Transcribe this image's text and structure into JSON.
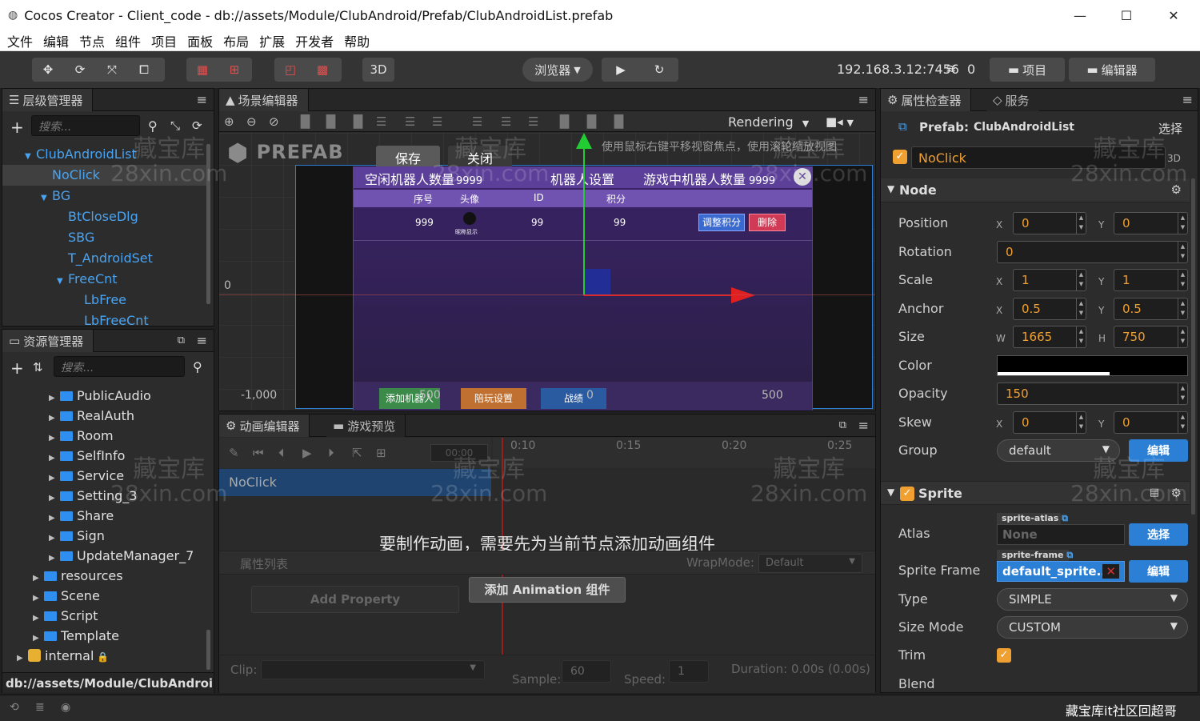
{
  "window": {
    "title": "Cocos Creator - Client_code - db://assets/Module/ClubAndroid/Prefab/ClubAndroidList.prefab"
  },
  "menu": [
    "文件",
    "编辑",
    "节点",
    "组件",
    "项目",
    "面板",
    "布局",
    "扩展",
    "开发者",
    "帮助"
  ],
  "toolbar": {
    "mode3d": "3D",
    "browser": "浏览器",
    "ip": "192.168.3.12:7456",
    "ip_count": "0",
    "project_btn": "项目",
    "editor_btn": "编辑器"
  },
  "hierarchy": {
    "title": "层级管理器",
    "search_placeholder": "搜索...",
    "items": [
      {
        "label": "ClubAndroidList",
        "indent": 0,
        "arrow": "▼"
      },
      {
        "label": "NoClick",
        "indent": 1,
        "arrow": ""
      },
      {
        "label": "BG",
        "indent": 1,
        "arrow": "▼"
      },
      {
        "label": "BtCloseDlg",
        "indent": 2,
        "arrow": ""
      },
      {
        "label": "SBG",
        "indent": 2,
        "arrow": ""
      },
      {
        "label": "T_AndroidSet",
        "indent": 2,
        "arrow": ""
      },
      {
        "label": "FreeCnt",
        "indent": 2,
        "arrow": "▼"
      },
      {
        "label": "LbFree",
        "indent": 3,
        "arrow": ""
      },
      {
        "label": "LbFreeCnt",
        "indent": 3,
        "arrow": ""
      }
    ]
  },
  "assets": {
    "title": "资源管理器",
    "search_placeholder": "搜索...",
    "items": [
      {
        "label": "PublicAudio",
        "indent": 2
      },
      {
        "label": "RealAuth",
        "indent": 2
      },
      {
        "label": "Room",
        "indent": 2
      },
      {
        "label": "SelfInfo",
        "indent": 2
      },
      {
        "label": "Service",
        "indent": 2
      },
      {
        "label": "Setting_3",
        "indent": 2
      },
      {
        "label": "Share",
        "indent": 2
      },
      {
        "label": "Sign",
        "indent": 2
      },
      {
        "label": "UpdateManager_7",
        "indent": 2
      },
      {
        "label": "resources",
        "indent": 1
      },
      {
        "label": "Scene",
        "indent": 1
      },
      {
        "label": "Script",
        "indent": 1
      },
      {
        "label": "Template",
        "indent": 1
      }
    ],
    "internal": "internal",
    "path": "db://assets/Module/ClubAndroi..."
  },
  "scene": {
    "title": "场景编辑器",
    "rendering": "Rendering",
    "prefab_label": "PREFAB",
    "save": "保存",
    "close": "关闭",
    "hint": "使用鼠标右键平移视窗焦点，使用滚轮缩放视图",
    "axis_0": "0",
    "axis_m1000": "-1,000",
    "axis_500": "500",
    "game": {
      "idle": "空闲机器人数量",
      "idle_num": "9999",
      "settings": "机器人设置",
      "ingame": "游戏中机器人数量",
      "ingame_num": "9999",
      "cols": [
        "序号",
        "头像",
        "ID",
        "积分"
      ],
      "row": {
        "no": "999",
        "name": "昵称显示",
        "id": "99",
        "score": "99"
      },
      "btn_adjust": "调整积分",
      "btn_delete": "删除",
      "btn_add": "添加机器人",
      "btn_play": "陪玩设置",
      "btn_record": "战绩",
      "bottom_nums": [
        "500",
        "0"
      ]
    }
  },
  "anim": {
    "tab_anim": "动画编辑器",
    "tab_preview": "游戏预览",
    "time_field": "00:00",
    "ruler": [
      "0:10",
      "0:15",
      "0:20",
      "0:25"
    ],
    "node": "NoClick",
    "msg": "要制作动画，需要先为当前节点添加动画组件",
    "prop_list": "属性列表",
    "wrap_label": "WrapMode:",
    "wrap_value": "Default",
    "add_property": "Add Property",
    "add_anim": "添加 Animation 组件",
    "clip_label": "Clip:",
    "sample_label": "Sample:",
    "sample_value": "60",
    "speed_label": "Speed:",
    "speed_value": "1",
    "duration": "Duration: 0.00s (0.00s)"
  },
  "inspector": {
    "tab_props": "属性检查器",
    "tab_service": "服务",
    "prefab_label": "Prefab:",
    "prefab_name": "ClubAndroidList",
    "select": "选择",
    "node_name": "NoClick",
    "tag_3d": "3D",
    "node_section": "Node",
    "position": {
      "label": "Position",
      "x": "0",
      "y": "0"
    },
    "rotation": {
      "label": "Rotation",
      "value": "0"
    },
    "scale": {
      "label": "Scale",
      "x": "1",
      "y": "1"
    },
    "anchor": {
      "label": "Anchor",
      "x": "0.5",
      "y": "0.5"
    },
    "size": {
      "label": "Size",
      "w": "1665",
      "h": "750"
    },
    "color": {
      "label": "Color",
      "value": "#000000"
    },
    "opacity": {
      "label": "Opacity",
      "value": "150"
    },
    "skew": {
      "label": "Skew",
      "x": "0",
      "y": "0"
    },
    "group": {
      "label": "Group",
      "value": "default",
      "edit": "编辑"
    },
    "sprite_section": "Sprite",
    "atlas": {
      "label": "Atlas",
      "tag": "sprite-atlas",
      "value": "None",
      "btn": "选择"
    },
    "sprite_frame": {
      "label": "Sprite Frame",
      "tag": "sprite-frame",
      "value": "default_sprite...",
      "btn": "编辑"
    },
    "type": {
      "label": "Type",
      "value": "SIMPLE"
    },
    "size_mode": {
      "label": "Size Mode",
      "value": "CUSTOM"
    },
    "trim": {
      "label": "Trim"
    },
    "blend": {
      "label": "Blend"
    },
    "xy": {
      "x": "X",
      "y": "Y",
      "w": "W",
      "h": "H"
    }
  },
  "watermark": {
    "line1": "藏宝库",
    "line2": "28xin.com"
  },
  "status": {
    "credit": "藏宝库it社区回超哥"
  },
  "colors": {
    "accent": "#2b7fd5",
    "orange": "#f0a030",
    "tree_blue": "#4aa3f0"
  }
}
